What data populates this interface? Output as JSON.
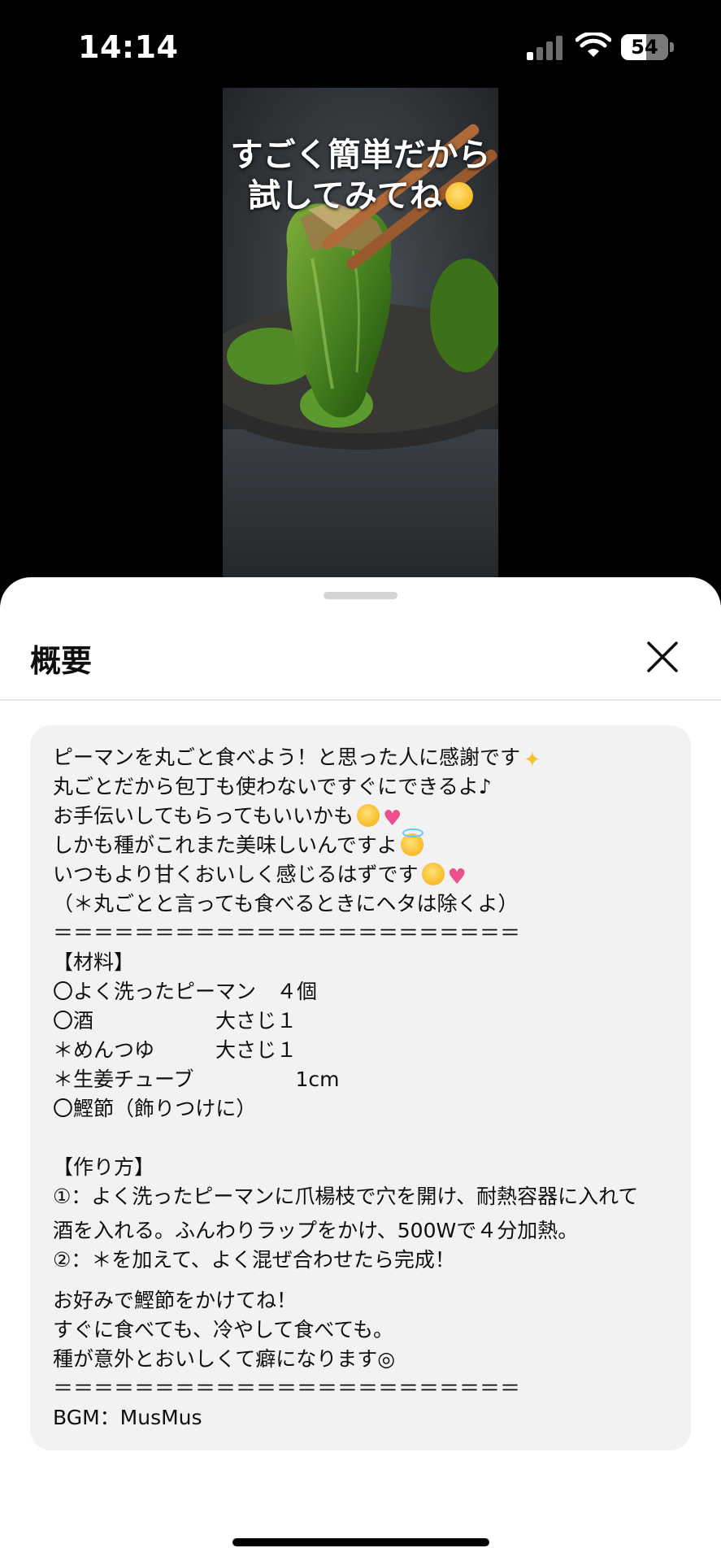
{
  "status_bar": {
    "time": "14:14",
    "battery": "54"
  },
  "video": {
    "caption": "すごく簡単だから\n試してみてね"
  },
  "sheet": {
    "title": "概要",
    "description": {
      "lines": [
        "ピーマンを丸ごと食べよう！と思った人に感謝です",
        "丸ごとだから包丁も使わないですぐにできるよ♪",
        "お手伝いしてもらってもいいかも",
        "しかも種がこれまた美味しいんですよ",
        "いつもより甘くおいしく感じるはずです",
        "（＊丸ごとと言っても食べるときにヘタは除くよ）",
        "＝＝＝＝＝＝＝＝＝＝＝＝＝＝＝＝＝＝＝＝＝＝＝",
        "【材料】",
        "〇よく洗ったピーマン　４個",
        "〇酒　　　　　　大さじ１",
        "＊めんつゆ　　　大さじ１",
        "＊生姜チューブ　　　　　1cm",
        "〇鰹節（飾りつけに）",
        "",
        "【作り方】",
        "①：よく洗ったピーマンに爪楊枝で穴を開け、耐熱容器に入れて",
        "酒を入れる。ふんわりラップをかけ、500Wで４分加熱。",
        "②：＊を加えて、よく混ぜ合わせたら完成！",
        "お好みで鰹節をかけてね！",
        "すぐに食べても、冷やして食べても。",
        "種が意外とおいしくて癖になります◎",
        "＝＝＝＝＝＝＝＝＝＝＝＝＝＝＝＝＝＝＝＝＝＝＝",
        "BGM：MusMus"
      ]
    }
  }
}
